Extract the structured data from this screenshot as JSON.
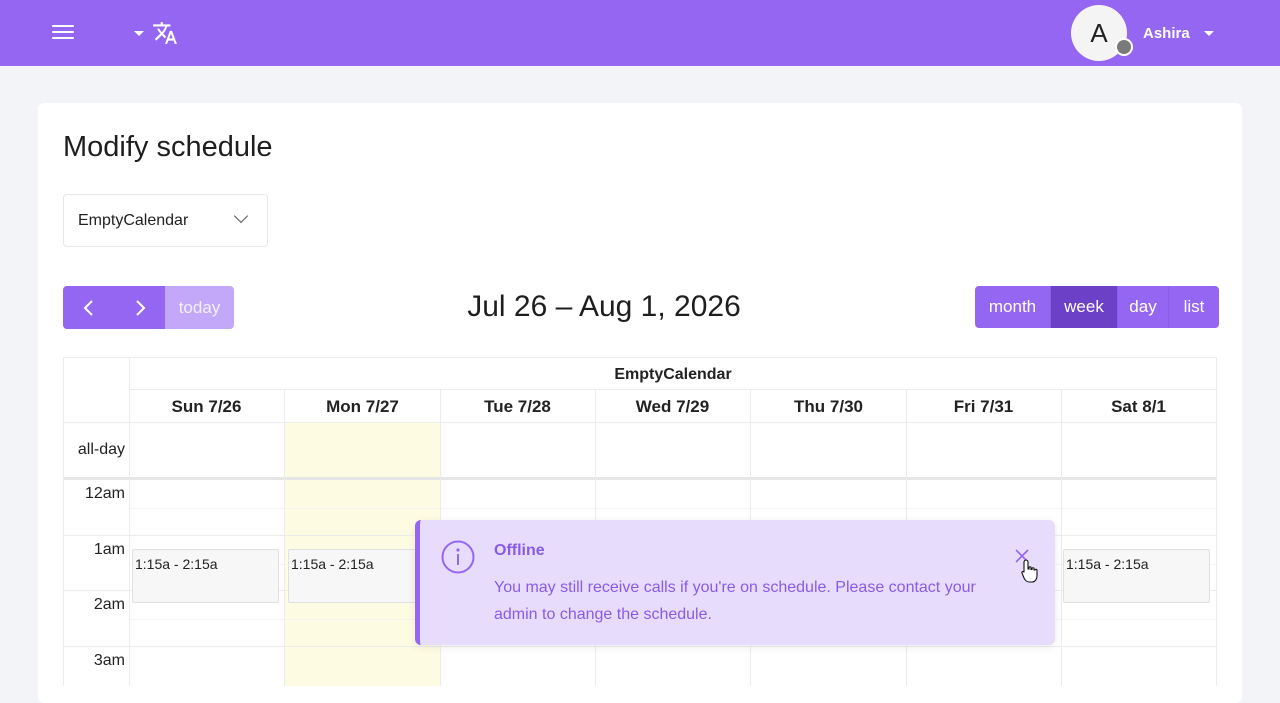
{
  "header": {
    "user_initial": "A",
    "user_name": "Ashira"
  },
  "page": {
    "title": "Modify schedule",
    "calendar_select": "EmptyCalendar"
  },
  "toolbar": {
    "prev_icon": "chevron-left-icon",
    "next_icon": "chevron-right-icon",
    "today_label": "today",
    "range_title": "Jul 26 – Aug 1, 2026",
    "views": [
      {
        "label": "month",
        "active": false
      },
      {
        "label": "week",
        "active": true
      },
      {
        "label": "day",
        "active": false
      },
      {
        "label": "list",
        "active": false
      }
    ]
  },
  "calendar": {
    "resource": "EmptyCalendar",
    "days": [
      "Sun 7/26",
      "Mon 7/27",
      "Tue 7/28",
      "Wed 7/29",
      "Thu 7/30",
      "Fri 7/31",
      "Sat 8/1"
    ],
    "allday_label": "all-day",
    "times": [
      "12am",
      "1am",
      "2am",
      "3am"
    ],
    "events": [
      {
        "day": 0,
        "label": "1:15a - 2:15a"
      },
      {
        "day": 1,
        "label": "1:15a - 2:15a"
      },
      {
        "day": 6,
        "label": "1:15a - 2:15a"
      }
    ]
  },
  "toast": {
    "title": "Offline",
    "message": "You may still receive calls if you're on schedule. Please contact your admin to change the schedule."
  },
  "colors": {
    "brand": "#9466f2",
    "active_view": "#6d40c8",
    "today_highlight": "#fefbe3",
    "toast_bg": "#e8dcfc"
  }
}
